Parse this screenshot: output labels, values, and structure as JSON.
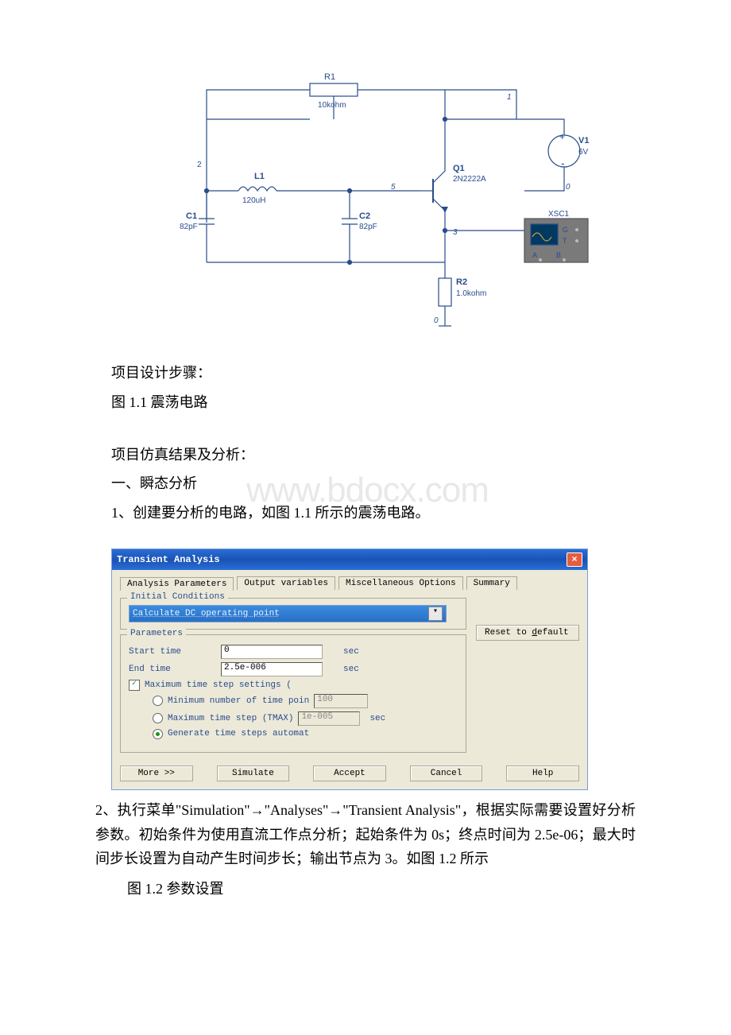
{
  "circuit": {
    "R1": {
      "ref": "R1",
      "value": "10kohm"
    },
    "V1": {
      "ref": "V1",
      "value": "6V"
    },
    "L1": {
      "ref": "L1",
      "value": "120uH"
    },
    "Q1": {
      "ref": "Q1",
      "value": "2N2222A"
    },
    "C1": {
      "ref": "C1",
      "value": "82pF"
    },
    "C2": {
      "ref": "C2",
      "value": "82pF"
    },
    "R2": {
      "ref": "R2",
      "value": "1.0kohm"
    },
    "XSC1": {
      "ref": "XSC1",
      "G": "G",
      "T": "T",
      "A": "A",
      "B": "B"
    },
    "nodes": {
      "n1": "1",
      "n2": "2",
      "n3": "3",
      "n5": "5",
      "n0a": "0",
      "n0b": "0"
    }
  },
  "text": {
    "steps": "项目设计步骤：",
    "fig11": "图 1.1 震荡电路",
    "sim_results": "项目仿真结果及分析：",
    "section1": "一、瞬态分析",
    "step1": "1、创建要分析的电路，如图 1.1 所示的震荡电路。",
    "watermark": "www.bdocx.com",
    "step2": "2、执行菜单\"Simulation\"→\"Analyses\"→\"Transient Analysis\"，根据实际需要设置好分析参数。初始条件为使用直流工作点分析；起始条件为 0s；终点时间为 2.5e-06；最大时间步长设置为自动产生时间步长；输出节点为 3。如图 1.2 所示",
    "fig12": "图 1.2 参数设置"
  },
  "dialog": {
    "title": "Transient Analysis",
    "tabs": {
      "t1": "Analysis Parameters",
      "t2": "Output variables",
      "t3": "Miscellaneous Options",
      "t4": "Summary"
    },
    "group_initial": "Initial Conditions",
    "initial_select": "Calculate DC operating point",
    "group_params": "Parameters",
    "start_label": "Start time",
    "start_value": "0",
    "end_label": "End time",
    "end_value": "2.5e-006",
    "sec": "sec",
    "max_step_check": "Maximum time step settings (",
    "min_points": "Minimum number of time poin",
    "min_points_val": "100",
    "max_tmax": "Maximum time step (TMAX)",
    "max_tmax_val": "1e-005",
    "gen_auto": "Generate time steps automat",
    "reset": "Reset to default",
    "reset_u": "d",
    "buttons": {
      "more": "More >>",
      "simulate": "Simulate",
      "accept": "Accept",
      "cancel": "Cancel",
      "help": "Help"
    }
  }
}
